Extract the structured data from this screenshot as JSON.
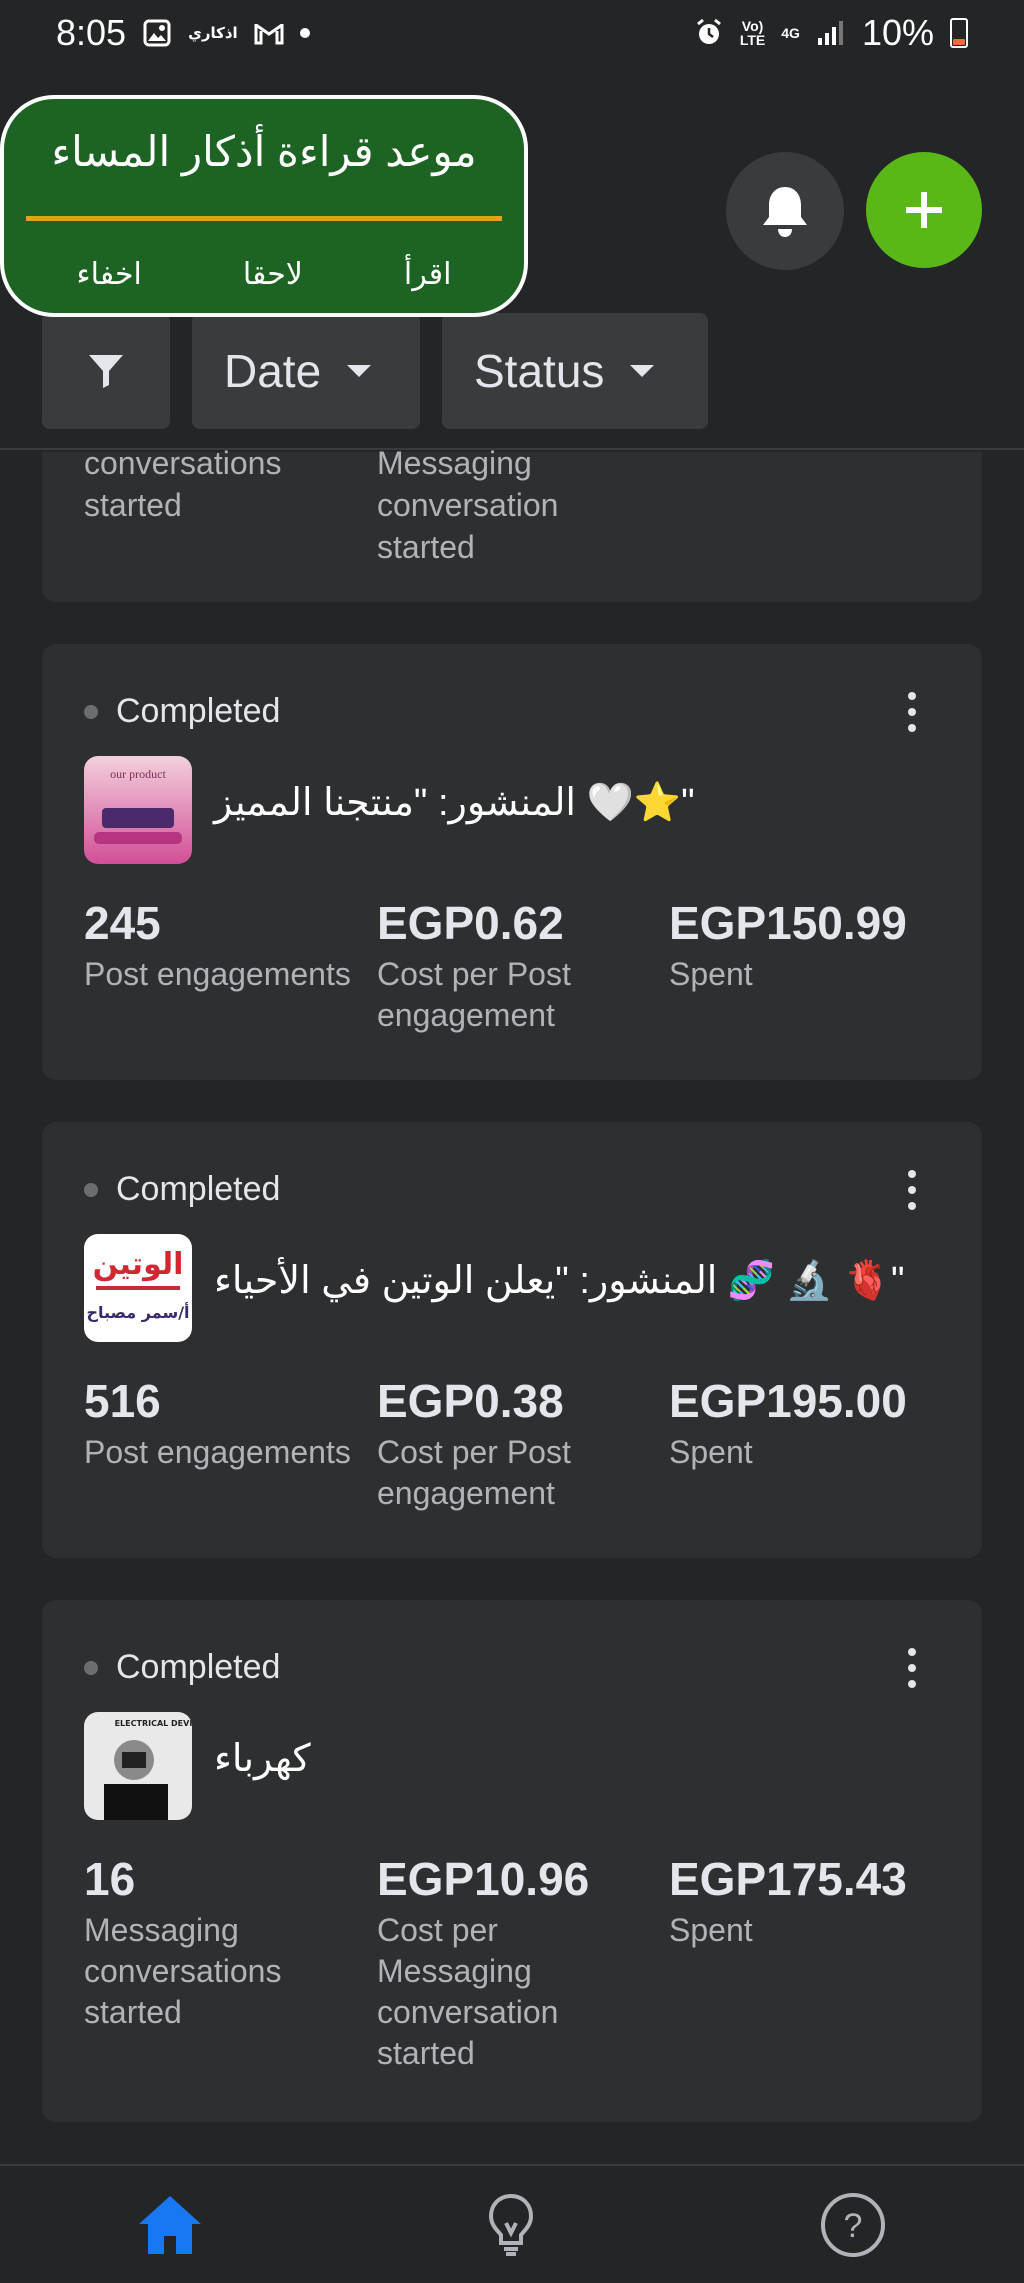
{
  "status_bar": {
    "time": "8:05",
    "app_badge": "اذكاري",
    "network_top": "Vo)",
    "network_bottom": "LTE",
    "network_gen": "4G",
    "battery": "10%"
  },
  "reminder": {
    "title": "موعد قراءة أذكار المساء",
    "actions": [
      "اقرأ",
      "لاحقا",
      "اخفاء"
    ]
  },
  "filters": {
    "date_label": "Date",
    "status_label": "Status"
  },
  "partial_card": {
    "left_label": "conversations\nstarted",
    "right_label": "Messaging\nconversation\nstarted"
  },
  "cards": [
    {
      "status": "Completed",
      "title": "المنشور: \"منتجنا المميز 🤍⭐\"",
      "thumb_text": "our product",
      "metrics": [
        {
          "value": "245",
          "label": "Post engagements"
        },
        {
          "value": "EGP0.62",
          "label": "Cost per Post\nengagement"
        },
        {
          "value": "EGP150.99",
          "label": "Spent"
        }
      ]
    },
    {
      "status": "Completed",
      "title": "المنشور: \"يعلن الوتين في الأحياء 🧬 🔬 🫀\"",
      "thumb_text": "الوتين",
      "thumb_sub": "أ/سمر مصباح",
      "metrics": [
        {
          "value": "516",
          "label": "Post engagements"
        },
        {
          "value": "EGP0.38",
          "label": "Cost per Post\nengagement"
        },
        {
          "value": "EGP195.00",
          "label": "Spent"
        }
      ]
    },
    {
      "status": "Completed",
      "title": "كهرباء",
      "thumb_text": "ELECTRICAL DEVICES",
      "metrics": [
        {
          "value": "16",
          "label": "Messaging\nconversations\nstarted"
        },
        {
          "value": "EGP10.96",
          "label": "Cost per\nMessaging\nconversation\nstarted"
        },
        {
          "value": "EGP175.43",
          "label": "Spent"
        }
      ]
    }
  ],
  "colors": {
    "background": "#242527",
    "card": "#2e2f31",
    "add_button": "#5ab718",
    "reminder_bg": "#1d6424",
    "reminder_line": "#d9a51c",
    "nav_active": "#1877f2"
  },
  "icons": {
    "bell": "bell-icon",
    "add": "plus-icon",
    "filter": "filter-icon",
    "home": "home-icon",
    "ideas": "lightbulb-icon",
    "help": "help-icon"
  }
}
